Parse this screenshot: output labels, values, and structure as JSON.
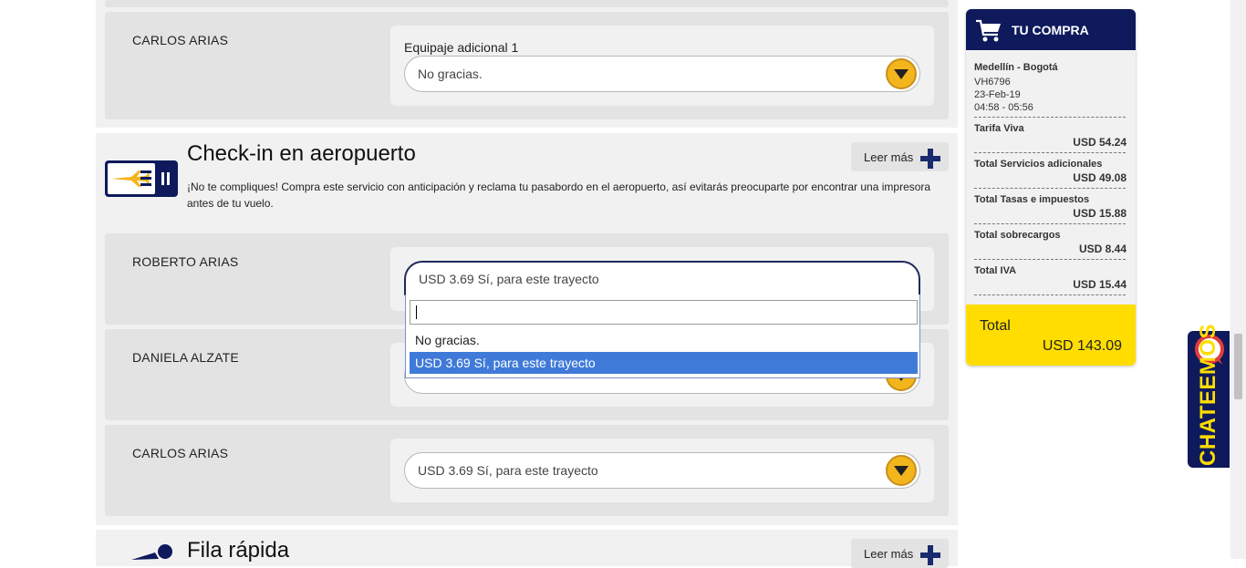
{
  "baggage_section": {
    "passenger": "CARLOS ARIAS",
    "field_label": "Equipaje adicional 1",
    "selected": "No gracias."
  },
  "checkin_section": {
    "title": "Check-in en aeropuerto",
    "description": "¡No te compliques! Compra este servicio con anticipación y reclama tu pasabordo en el aeropuerto, así evitarás preocuparte por encontrar una impresora antes de tu vuelo.",
    "leer_mas": "Leer más",
    "passengers": [
      {
        "name": "ROBERTO ARIAS",
        "selected": "USD 3.69 Sí, para este trayecto"
      },
      {
        "name": "DANIELA ALZATE",
        "selected": ""
      },
      {
        "name": "CARLOS ARIAS",
        "selected": "USD 3.69 Sí, para este trayecto"
      }
    ],
    "dropdown": {
      "search_value": "",
      "options": [
        "No gracias.",
        "USD 3.69 Sí, para este trayecto"
      ],
      "highlighted_index": 1
    }
  },
  "fila_section": {
    "title": "Fila rápida",
    "leer_mas": "Leer más"
  },
  "cart": {
    "title": "TU COMPRA",
    "route": "Medellín - Bogotá",
    "flight": "VH6796",
    "date": "23-Feb-19",
    "time": "04:58 - 05:56",
    "lines": [
      {
        "label": "Tarifa Viva",
        "value": "USD 54.24"
      },
      {
        "label": "Total Servicios adicionales",
        "value": "USD 49.08"
      },
      {
        "label": "Total Tasas e impuestos",
        "value": "USD 15.88"
      },
      {
        "label": "Total sobrecargos",
        "value": "USD 8.44"
      },
      {
        "label": "Total IVA",
        "value": "USD 15.44"
      }
    ],
    "total_label": "Total",
    "total_value": "USD 143.09"
  },
  "chat": {
    "label": "CHATEEMOS"
  },
  "colors": {
    "navy": "#0e1a5c",
    "yellow": "#ffdd00",
    "arrow": "#f2b51c",
    "highlight": "#3f7ad8"
  }
}
